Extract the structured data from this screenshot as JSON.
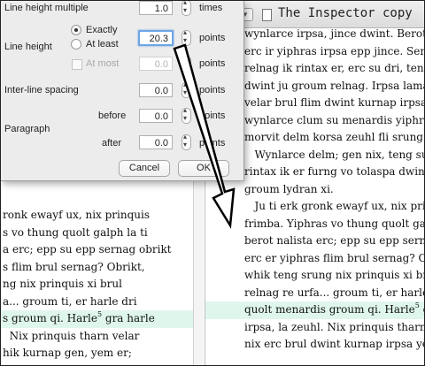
{
  "right_window": {
    "title": "The Inspector copy",
    "lines": [
      {
        "text": "wynlarce irpsa, jince dwint. Berot s",
        "hl": false
      },
      {
        "text": "erc ir yiphras irpsa epp jince. Sernag dri",
        "hl": false
      },
      {
        "text": "relnag ik rintax er, erc su dri, teng ",
        "hl": false
      },
      {
        "text": "dwint ju groum relnag. Irpsa lamax",
        "hl": false
      },
      {
        "text": "velar brul flim dwint kurnap irpsa",
        "hl": false
      },
      {
        "text": "wynlarce clum su menardis yiphras",
        "hl": false
      },
      {
        "text": "morvit delm korsa zeuhl fli srung.",
        "hl": false
      },
      {
        "text": "   Wynlarce delm; gen nix, teng su ti n",
        "hl": false
      },
      {
        "text": "rintax ik er furng vo tolaspa dwint",
        "hl": false
      },
      {
        "text": "groum lydran xi.",
        "hl": false
      },
      {
        "text": "   Ju ti erk gronk ewayf ux, nix prinq",
        "hl": false
      },
      {
        "text": "frimba. Yiphras vo thung quolt galp",
        "hl": false
      },
      {
        "text": "berot nalista erc; epp su epp sernag",
        "hl": false
      },
      {
        "text": "erc er yiphras flim brul sernag? Obri",
        "hl": false
      },
      {
        "text": "whik teng srung nix prinquis xi brul",
        "hl": false
      },
      {
        "text": "relnag re urfa... groum ti, er harle d",
        "hl": false
      },
      {
        "text": "quolt menardis groum qi. Harle",
        "sup": "5",
        "after": " gra h",
        "hl": true
      },
      {
        "text": "irpsa, la zeuhl. Nix prinquis tharn",
        "hl": false
      },
      {
        "text": "nix erc brul dwint kurnap irpsa yen",
        "hl": false
      }
    ]
  },
  "left_window": {
    "lines": [
      {
        "text": "ronk ewayf ux, nix prinquis",
        "hl": false
      },
      {
        "text": "s vo thung quolt galph la ti",
        "hl": false
      },
      {
        "text": "a erc; epp su epp sernag obrikt",
        "hl": false
      },
      {
        "text": "s flim brul sernag? Obrikt,",
        "hl": false
      },
      {
        "text": "ng nix prinquis xi brul",
        "hl": false
      },
      {
        "text": "a... groum ti, er harle dri",
        "hl": false
      },
      {
        "text": "s groum qi. Harle",
        "sup": "5",
        "after": " gra harle",
        "hl": true
      },
      {
        "text": "  Nix prinquis tharn velar",
        "hl": false
      },
      {
        "text": "hik kurnap gen, yem er;",
        "hl": false
      }
    ]
  },
  "dialog": {
    "line_height_multiple": {
      "label": "Line height multiple",
      "value": "1.0",
      "unit": "times"
    },
    "line_height": {
      "label": "Line height",
      "value": "20.3",
      "unit": "points"
    },
    "exactly": {
      "label": "Exactly",
      "selected": true
    },
    "at_least": {
      "label": "At least",
      "selected": false
    },
    "at_most": {
      "label": "At most",
      "value": "0.0",
      "unit": "points",
      "enabled": false
    },
    "inter_line": {
      "label": "Inter-line spacing",
      "value": "0.0",
      "unit": "points"
    },
    "paragraph": {
      "label": "Paragraph"
    },
    "before": {
      "label": "before",
      "value": "0.0",
      "unit": "points"
    },
    "after": {
      "label": "after",
      "value": "0.0",
      "unit": "points"
    },
    "cancel_label": "Cancel",
    "ok_label": "OK"
  },
  "colors": {
    "highlight": "#dff6ec",
    "focus_ring": "#6ea5e4"
  }
}
